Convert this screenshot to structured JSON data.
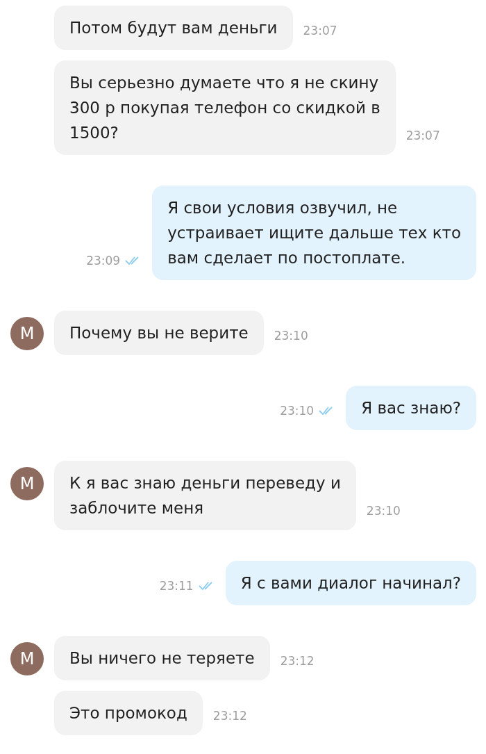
{
  "messages": [
    {
      "kind": "in",
      "text": "Потом будут вам деньги",
      "time": "23:07"
    },
    {
      "kind": "in",
      "text": "Вы серьезно думаете что я не скину\n300 р покупая телефон со скидкой в\n1500?",
      "time": "23:07"
    },
    {
      "kind": "out",
      "text": "Я свои условия озвучил, не\nустраивает ищите дальше тех кто\nвам сделает по постоплате.",
      "time": "23:09",
      "read": true
    },
    {
      "kind": "in",
      "avatar": "M",
      "text": "Почему вы не верите",
      "time": "23:10"
    },
    {
      "kind": "out",
      "text": "Я вас знаю?",
      "time": "23:10",
      "read": true
    },
    {
      "kind": "in",
      "avatar": "M",
      "text": "К я вас знаю деньги переведу и\nзаблочите меня",
      "time": "23:10"
    },
    {
      "kind": "out",
      "text": "Я с вами диалог начинал?",
      "time": "23:11",
      "read": true
    },
    {
      "kind": "in",
      "avatar": "M",
      "text": "Вы ничего не теряете",
      "time": "23:12"
    },
    {
      "kind": "in",
      "text": "Это промокод",
      "time": "23:12"
    }
  ]
}
